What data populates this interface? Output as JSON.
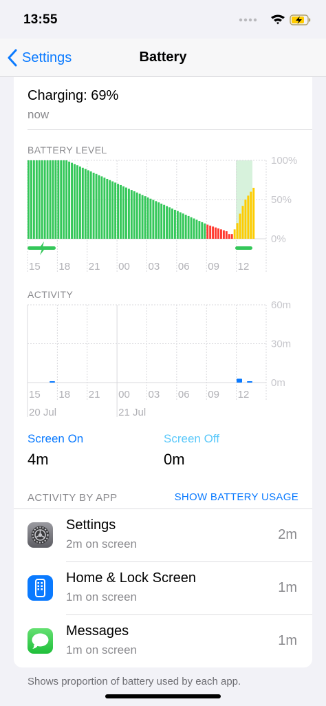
{
  "status_bar": {
    "time": "13:55",
    "battery_charging": true
  },
  "nav": {
    "back_label": "Settings",
    "title": "Battery"
  },
  "charging": {
    "title": "Charging: 69%",
    "subtitle": "now"
  },
  "battery_level": {
    "label": "BATTERY LEVEL",
    "y_ticks": [
      "100%",
      "50%",
      "0%"
    ],
    "x_ticks": [
      "15",
      "18",
      "21",
      "00",
      "03",
      "06",
      "09",
      "12"
    ]
  },
  "activity": {
    "label": "ACTIVITY",
    "y_ticks": [
      "60m",
      "30m",
      "0m"
    ],
    "x_ticks": [
      "15",
      "18",
      "21",
      "00",
      "03",
      "06",
      "09",
      "12"
    ],
    "date_labels": [
      "20 Jul",
      "21 Jul"
    ]
  },
  "screen_on": {
    "label": "Screen On",
    "value": "4m"
  },
  "screen_off": {
    "label": "Screen Off",
    "value": "0m"
  },
  "activity_by_app": {
    "label": "ACTIVITY BY APP",
    "link": "SHOW BATTERY USAGE"
  },
  "apps": [
    {
      "name": "Settings",
      "detail": "2m on screen",
      "time": "2m",
      "icon": "settings-gear-icon"
    },
    {
      "name": "Home & Lock Screen",
      "detail": "1m on screen",
      "time": "1m",
      "icon": "home-lock-screen-icon"
    },
    {
      "name": "Messages",
      "detail": "1m on screen",
      "time": "1m",
      "icon": "messages-bubble-icon"
    }
  ],
  "footer_note": "Shows proportion of battery used by each app.",
  "colors": {
    "accent": "#0a7aff",
    "screen_off": "#5ac8fa",
    "battery_green": "#34c759",
    "battery_red": "#ff3b30",
    "battery_yellow": "#ffcc00",
    "activity_bar": "#0a7aff"
  }
}
